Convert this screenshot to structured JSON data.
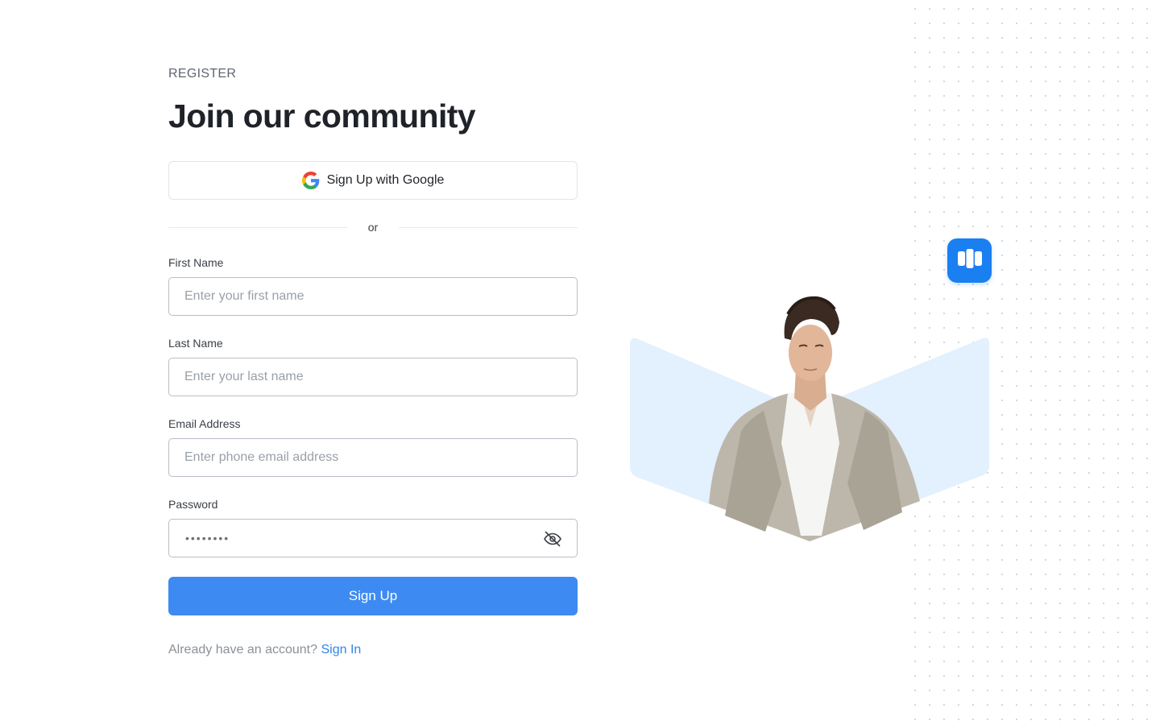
{
  "header": {
    "eyebrow": "REGISTER",
    "title": "Join our community"
  },
  "google_button": {
    "label": "Sign Up with Google",
    "icon": "google-icon"
  },
  "divider": {
    "label": "or"
  },
  "fields": {
    "first_name": {
      "label": "First Name",
      "placeholder": "Enter your first name",
      "value": ""
    },
    "last_name": {
      "label": "Last Name",
      "placeholder": "Enter your last name",
      "value": ""
    },
    "email": {
      "label": "Email Address",
      "placeholder": "Enter phone email address",
      "value": ""
    },
    "password": {
      "label": "Password",
      "masked_value": "••••••••",
      "toggle_icon": "eye-off-icon"
    }
  },
  "submit": {
    "label": "Sign Up"
  },
  "footer": {
    "prompt": "Already have an account?",
    "link": "Sign In"
  },
  "colors": {
    "primary": "#3d8bf2",
    "link": "#2f86e8",
    "badge": "#1a7ff0",
    "hero_bg": "#e3f0fd",
    "text": "#1f2329"
  },
  "decor": {
    "app_badge_icon": "columns-icon",
    "hero_image": "portrait-of-man-in-suit"
  }
}
